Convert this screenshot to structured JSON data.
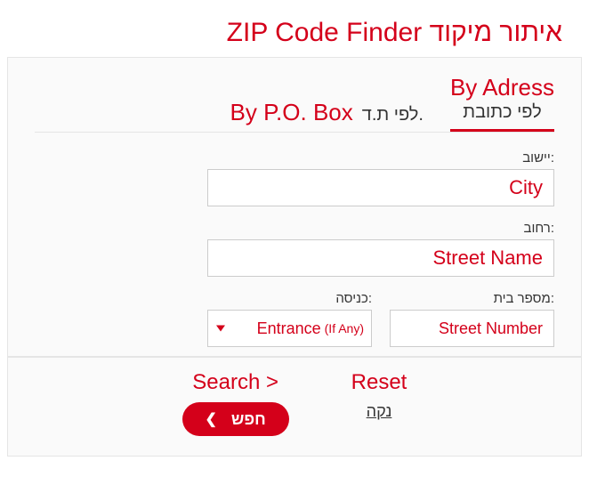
{
  "title_en": "ZIP Code Finder",
  "title_he": "איתור מיקוד",
  "tabs": {
    "address": {
      "en": "By Adress",
      "he": "לפי כתובת"
    },
    "pobox": {
      "en": "By P.O. Box",
      "he": "לפי ת.ד."
    }
  },
  "fields": {
    "city": {
      "label": "יישוב:",
      "placeholder": "City"
    },
    "street": {
      "label": "רחוב:",
      "placeholder": "Street Name"
    },
    "house": {
      "label": "מספר בית:",
      "placeholder": "Street Number"
    },
    "entrance": {
      "label": "כניסה:",
      "selected": "Entrance",
      "note": "(If Any)"
    }
  },
  "actions": {
    "search_en": "Search >",
    "search_he": "חפש",
    "reset_en": "Reset",
    "reset_he": "נקה"
  }
}
